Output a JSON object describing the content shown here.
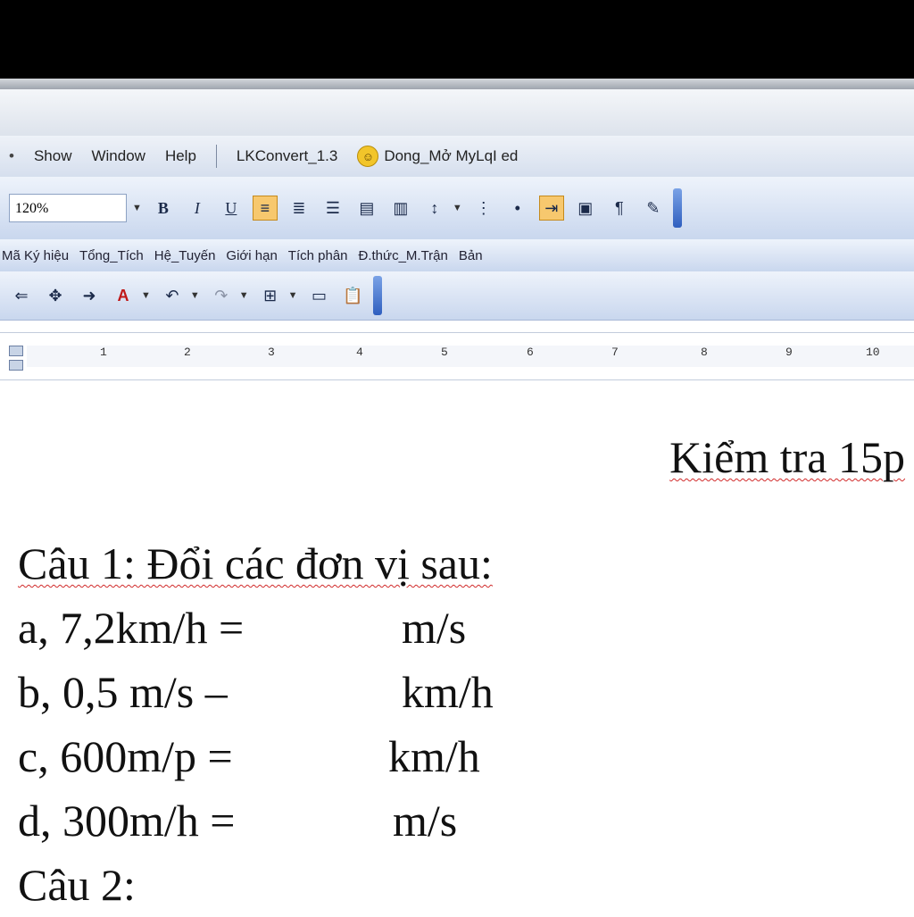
{
  "menu": {
    "items": [
      "Show",
      "Window",
      "Help"
    ],
    "convert": "LKConvert_1.3",
    "plugin": "Dong_Mở MyLqI ed"
  },
  "toolbar": {
    "zoom": "120%",
    "bold": "B",
    "italic": "I",
    "underline": "U"
  },
  "math_toolbar": {
    "items": [
      "Mã Ký hiệu",
      "Tổng_Tích",
      "Hệ_Tuyến",
      "Giới hạn",
      "Tích phân",
      "Đ.thức_M.Trận",
      "Bản"
    ]
  },
  "ruler": {
    "ticks": [
      "1",
      "2",
      "3",
      "4",
      "5",
      "6",
      "7",
      "8",
      "9",
      "10"
    ]
  },
  "document": {
    "title": "Kiểm tra 15p",
    "question1": "Câu 1: Đổi các đơn vị sau:",
    "lines": [
      {
        "left": "a, 7,2km/h =",
        "right": "m/s"
      },
      {
        "left": "b, 0,5 m/s –",
        "right": "km/h"
      },
      {
        "left": "c, 600m/p  =",
        "right": "km/h"
      },
      {
        "left": "d, 300m/h =",
        "right": "m/s"
      }
    ],
    "question2": "Câu 2:"
  }
}
